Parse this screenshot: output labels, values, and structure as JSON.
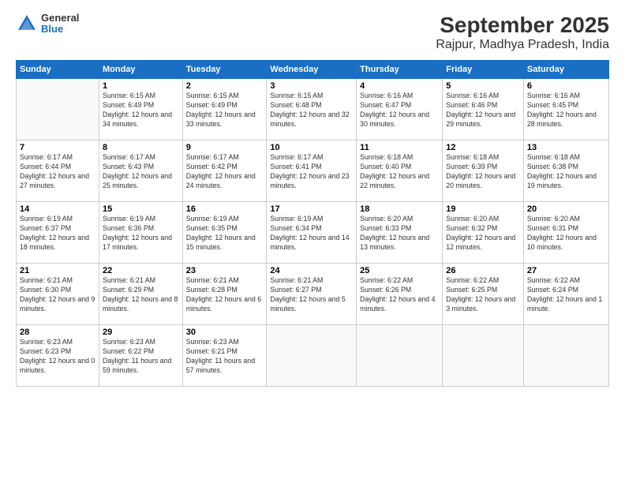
{
  "header": {
    "logo": {
      "general": "General",
      "blue": "Blue"
    },
    "title": "September 2025",
    "subtitle": "Rajpur, Madhya Pradesh, India"
  },
  "days_of_week": [
    "Sunday",
    "Monday",
    "Tuesday",
    "Wednesday",
    "Thursday",
    "Friday",
    "Saturday"
  ],
  "weeks": [
    [
      {
        "day": "",
        "sunrise": "",
        "sunset": "",
        "daylight": ""
      },
      {
        "day": "1",
        "sunrise": "Sunrise: 6:15 AM",
        "sunset": "Sunset: 6:49 PM",
        "daylight": "Daylight: 12 hours and 34 minutes."
      },
      {
        "day": "2",
        "sunrise": "Sunrise: 6:15 AM",
        "sunset": "Sunset: 6:49 PM",
        "daylight": "Daylight: 12 hours and 33 minutes."
      },
      {
        "day": "3",
        "sunrise": "Sunrise: 6:15 AM",
        "sunset": "Sunset: 6:48 PM",
        "daylight": "Daylight: 12 hours and 32 minutes."
      },
      {
        "day": "4",
        "sunrise": "Sunrise: 6:16 AM",
        "sunset": "Sunset: 6:47 PM",
        "daylight": "Daylight: 12 hours and 30 minutes."
      },
      {
        "day": "5",
        "sunrise": "Sunrise: 6:16 AM",
        "sunset": "Sunset: 6:46 PM",
        "daylight": "Daylight: 12 hours and 29 minutes."
      },
      {
        "day": "6",
        "sunrise": "Sunrise: 6:16 AM",
        "sunset": "Sunset: 6:45 PM",
        "daylight": "Daylight: 12 hours and 28 minutes."
      }
    ],
    [
      {
        "day": "7",
        "sunrise": "Sunrise: 6:17 AM",
        "sunset": "Sunset: 6:44 PM",
        "daylight": "Daylight: 12 hours and 27 minutes."
      },
      {
        "day": "8",
        "sunrise": "Sunrise: 6:17 AM",
        "sunset": "Sunset: 6:43 PM",
        "daylight": "Daylight: 12 hours and 25 minutes."
      },
      {
        "day": "9",
        "sunrise": "Sunrise: 6:17 AM",
        "sunset": "Sunset: 6:42 PM",
        "daylight": "Daylight: 12 hours and 24 minutes."
      },
      {
        "day": "10",
        "sunrise": "Sunrise: 6:17 AM",
        "sunset": "Sunset: 6:41 PM",
        "daylight": "Daylight: 12 hours and 23 minutes."
      },
      {
        "day": "11",
        "sunrise": "Sunrise: 6:18 AM",
        "sunset": "Sunset: 6:40 PM",
        "daylight": "Daylight: 12 hours and 22 minutes."
      },
      {
        "day": "12",
        "sunrise": "Sunrise: 6:18 AM",
        "sunset": "Sunset: 6:39 PM",
        "daylight": "Daylight: 12 hours and 20 minutes."
      },
      {
        "day": "13",
        "sunrise": "Sunrise: 6:18 AM",
        "sunset": "Sunset: 6:38 PM",
        "daylight": "Daylight: 12 hours and 19 minutes."
      }
    ],
    [
      {
        "day": "14",
        "sunrise": "Sunrise: 6:19 AM",
        "sunset": "Sunset: 6:37 PM",
        "daylight": "Daylight: 12 hours and 18 minutes."
      },
      {
        "day": "15",
        "sunrise": "Sunrise: 6:19 AM",
        "sunset": "Sunset: 6:36 PM",
        "daylight": "Daylight: 12 hours and 17 minutes."
      },
      {
        "day": "16",
        "sunrise": "Sunrise: 6:19 AM",
        "sunset": "Sunset: 6:35 PM",
        "daylight": "Daylight: 12 hours and 15 minutes."
      },
      {
        "day": "17",
        "sunrise": "Sunrise: 6:19 AM",
        "sunset": "Sunset: 6:34 PM",
        "daylight": "Daylight: 12 hours and 14 minutes."
      },
      {
        "day": "18",
        "sunrise": "Sunrise: 6:20 AM",
        "sunset": "Sunset: 6:33 PM",
        "daylight": "Daylight: 12 hours and 13 minutes."
      },
      {
        "day": "19",
        "sunrise": "Sunrise: 6:20 AM",
        "sunset": "Sunset: 6:32 PM",
        "daylight": "Daylight: 12 hours and 12 minutes."
      },
      {
        "day": "20",
        "sunrise": "Sunrise: 6:20 AM",
        "sunset": "Sunset: 6:31 PM",
        "daylight": "Daylight: 12 hours and 10 minutes."
      }
    ],
    [
      {
        "day": "21",
        "sunrise": "Sunrise: 6:21 AM",
        "sunset": "Sunset: 6:30 PM",
        "daylight": "Daylight: 12 hours and 9 minutes."
      },
      {
        "day": "22",
        "sunrise": "Sunrise: 6:21 AM",
        "sunset": "Sunset: 6:29 PM",
        "daylight": "Daylight: 12 hours and 8 minutes."
      },
      {
        "day": "23",
        "sunrise": "Sunrise: 6:21 AM",
        "sunset": "Sunset: 6:28 PM",
        "daylight": "Daylight: 12 hours and 6 minutes."
      },
      {
        "day": "24",
        "sunrise": "Sunrise: 6:21 AM",
        "sunset": "Sunset: 6:27 PM",
        "daylight": "Daylight: 12 hours and 5 minutes."
      },
      {
        "day": "25",
        "sunrise": "Sunrise: 6:22 AM",
        "sunset": "Sunset: 6:26 PM",
        "daylight": "Daylight: 12 hours and 4 minutes."
      },
      {
        "day": "26",
        "sunrise": "Sunrise: 6:22 AM",
        "sunset": "Sunset: 6:25 PM",
        "daylight": "Daylight: 12 hours and 3 minutes."
      },
      {
        "day": "27",
        "sunrise": "Sunrise: 6:22 AM",
        "sunset": "Sunset: 6:24 PM",
        "daylight": "Daylight: 12 hours and 1 minute."
      }
    ],
    [
      {
        "day": "28",
        "sunrise": "Sunrise: 6:23 AM",
        "sunset": "Sunset: 6:23 PM",
        "daylight": "Daylight: 12 hours and 0 minutes."
      },
      {
        "day": "29",
        "sunrise": "Sunrise: 6:23 AM",
        "sunset": "Sunset: 6:22 PM",
        "daylight": "Daylight: 11 hours and 59 minutes."
      },
      {
        "day": "30",
        "sunrise": "Sunrise: 6:23 AM",
        "sunset": "Sunset: 6:21 PM",
        "daylight": "Daylight: 11 hours and 57 minutes."
      },
      {
        "day": "",
        "sunrise": "",
        "sunset": "",
        "daylight": ""
      },
      {
        "day": "",
        "sunrise": "",
        "sunset": "",
        "daylight": ""
      },
      {
        "day": "",
        "sunrise": "",
        "sunset": "",
        "daylight": ""
      },
      {
        "day": "",
        "sunrise": "",
        "sunset": "",
        "daylight": ""
      }
    ]
  ]
}
